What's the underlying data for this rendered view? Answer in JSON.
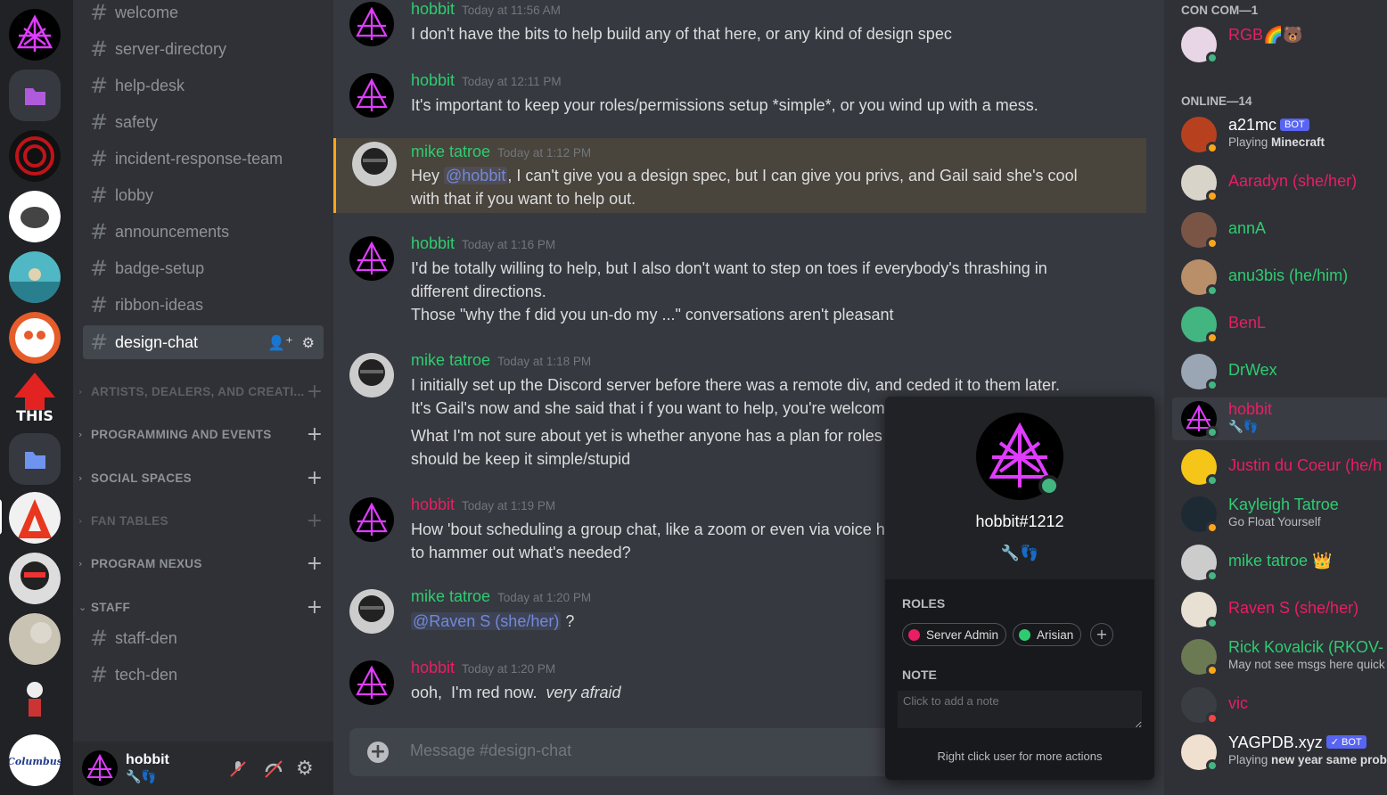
{
  "channels": [
    {
      "name": "welcome"
    },
    {
      "name": "server-directory"
    },
    {
      "name": "help-desk"
    },
    {
      "name": "safety"
    },
    {
      "name": "incident-response-team"
    },
    {
      "name": "lobby"
    },
    {
      "name": "announcements"
    },
    {
      "name": "badge-setup"
    },
    {
      "name": "ribbon-ideas"
    },
    {
      "name": "design-chat"
    }
  ],
  "categories": [
    {
      "name": "ARTISTS, DEALERS, AND CREATI..."
    },
    {
      "name": "PROGRAMMING AND EVENTS"
    },
    {
      "name": "SOCIAL SPACES"
    },
    {
      "name": "FAN TABLES"
    },
    {
      "name": "PROGRAM NEXUS"
    },
    {
      "name": "STAFF"
    }
  ],
  "staff_channels": [
    {
      "name": "staff-den"
    },
    {
      "name": "tech-den"
    }
  ],
  "user": {
    "name": "hobbit",
    "badges": "🔧👣"
  },
  "messages": [
    {
      "author": "hobbit",
      "time": "Today at 11:56 AM",
      "lines": [
        "I don't have the bits to help build any of that here, or any kind of design spec"
      ]
    },
    {
      "author": "hobbit",
      "time": "Today at 12:11 PM",
      "lines": [
        "It's important to keep your roles/permissions setup *simple*, or you wind up with a mess."
      ]
    },
    {
      "author": "mike tatroe",
      "time": "Today at 1:12 PM",
      "pre": "Hey ",
      "mention": "@hobbit",
      "post": ", I can't give you a design spec, but I can give you privs, and Gail said she's cool",
      "lines": [
        "with that if you want to help out."
      ]
    },
    {
      "author": "hobbit",
      "time": "Today at 1:16 PM",
      "lines": [
        "I'd be totally willing to help, but I also don't want to step on toes if everybody's thrashing in",
        "different directions.",
        "Those \"why the f did you un-do my ...\" conversations aren't pleasant"
      ]
    },
    {
      "author": "mike tatroe",
      "time": "Today at 1:18 PM",
      "lines": [
        "I initially set up the Discord server before there was a remote div, and ceded it to them later.",
        "It's Gail's now and she said that i f you want to help, you're welcom"
      ],
      "lines2": [
        "What I'm not sure about yet is whether anyone has a plan for roles",
        "should be keep it simple/stupid"
      ]
    },
    {
      "author": "hobbit",
      "time": "Today at 1:19 PM",
      "lines": [
        "How  'bout scheduling a group chat, like a zoom or even via voice h",
        "to hammer out what's needed?"
      ]
    },
    {
      "author": "mike tatroe",
      "time": "Today at 1:20 PM",
      "mention": "@Raven S (she/her)",
      "post": " ?"
    },
    {
      "author": "hobbit",
      "time": "Today at 1:20 PM",
      "pre": "ooh,  I'm red now.  ",
      "italic": "very afraid"
    }
  ],
  "composer": {
    "placeholder": "Message #design-chat"
  },
  "popout": {
    "tag": "hobbit#1212",
    "badges": "🔧👣",
    "roles_label": "ROLES",
    "roles": [
      {
        "name": "Server Admin",
        "color": "#e91e63"
      },
      {
        "name": "Arisian",
        "color": "#2ecc71"
      }
    ],
    "add_role": "+",
    "note_label": "NOTE",
    "note_placeholder": "Click to add a note",
    "hint": "Right click user for more actions"
  },
  "member_groups": [
    {
      "label": "CON COM—1"
    },
    {
      "label": "ONLINE—14"
    }
  ],
  "members": [
    {
      "name": "RGB🌈🐻",
      "color": "#e91e63",
      "status": "on"
    },
    {
      "name": "a21mc",
      "color": "#ffffff",
      "status": "idle",
      "bot": "BOT",
      "sub_pre": "Playing ",
      "sub_bold": "Minecraft"
    },
    {
      "name": "Aaradyn (she/her)",
      "color": "#e91e63",
      "status": "idle"
    },
    {
      "name": "annA",
      "color": "#2ecc71",
      "status": "idle"
    },
    {
      "name": "anu3bis (he/him)",
      "color": "#2ecc71",
      "status": "on"
    },
    {
      "name": "BenL",
      "color": "#e91e63",
      "status": "idle"
    },
    {
      "name": "DrWex",
      "color": "#2ecc71",
      "status": "on"
    },
    {
      "name": "hobbit",
      "color": "#e91e63",
      "status": "on",
      "sub_pre": "🔧👣"
    },
    {
      "name": "Justin du Coeur (he/h",
      "color": "#e91e63",
      "status": "on"
    },
    {
      "name": "Kayleigh Tatroe",
      "color": "#2ecc71",
      "status": "idle",
      "sub_pre": "Go Float Yourself"
    },
    {
      "name": "mike tatroe 👑",
      "color": "#2ecc71",
      "status": "on"
    },
    {
      "name": "Raven S (she/her)",
      "color": "#e91e63",
      "status": "on"
    },
    {
      "name": "Rick Kovalcik (RKOV-",
      "color": "#2ecc71",
      "status": "idle",
      "sub_pre": "May not see msgs here quick"
    },
    {
      "name": "vic",
      "color": "#e91e63",
      "status": "dnd"
    },
    {
      "name": "YAGPDB.xyz",
      "color": "#ffffff",
      "status": "on",
      "bot": "✓ BOT",
      "sub_pre": "Playing ",
      "sub_bold": "new year same probl"
    }
  ]
}
